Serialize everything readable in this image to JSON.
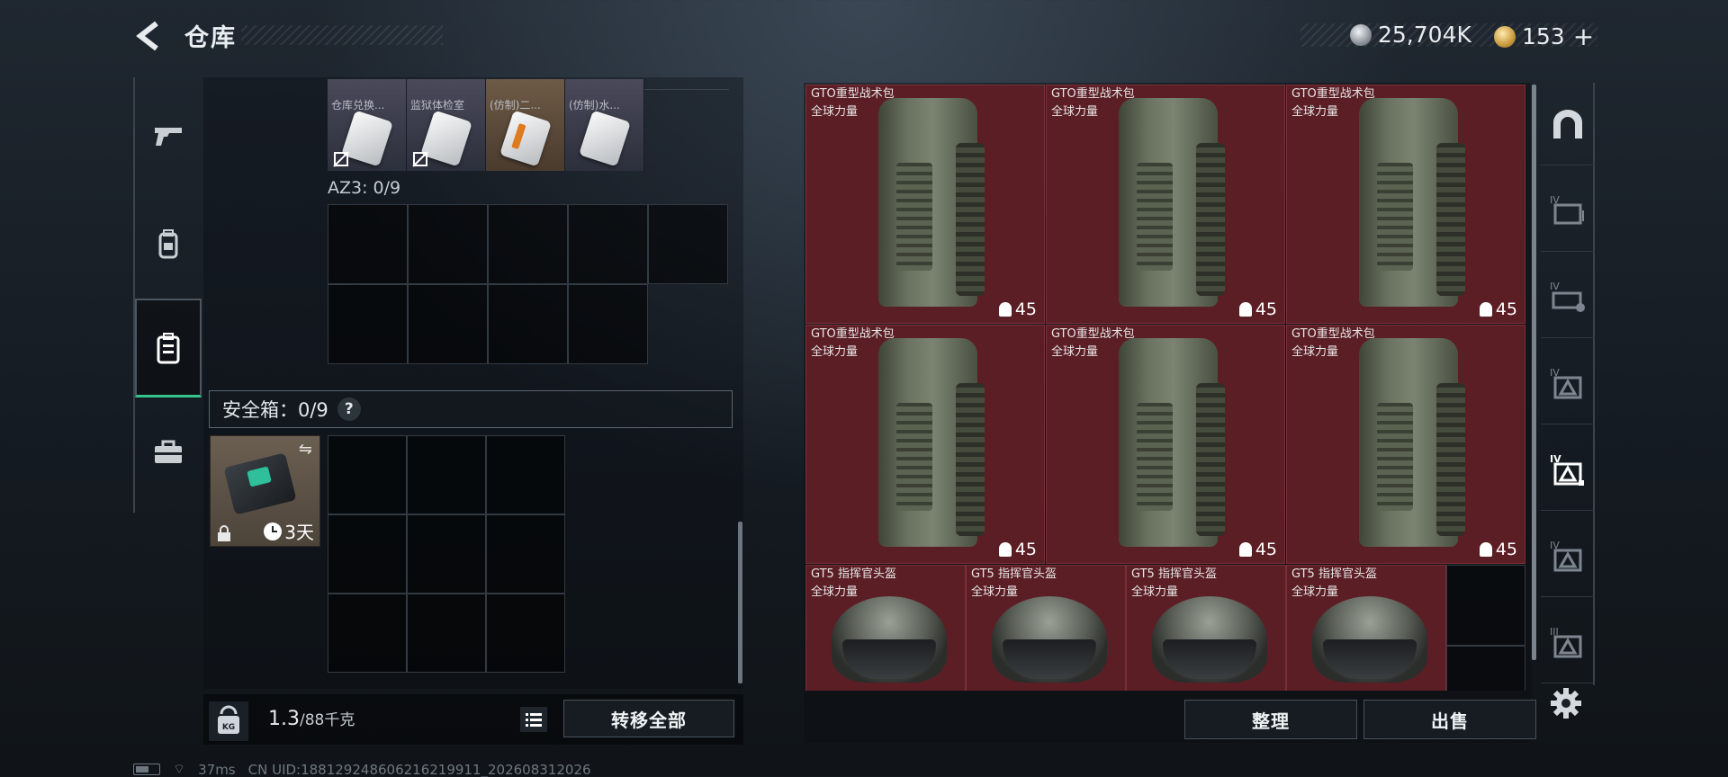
{
  "header": {
    "title": "仓库",
    "currency_silver": "25,704K",
    "currency_gold": "153",
    "add_label": "+"
  },
  "left_nav": {
    "items": [
      {
        "name": "weapons",
        "icon": "pistol-icon"
      },
      {
        "name": "equipment",
        "icon": "backpack-icon"
      },
      {
        "name": "storage",
        "icon": "case-icon",
        "active": true
      },
      {
        "name": "kit",
        "icon": "briefcase-icon"
      }
    ]
  },
  "carried": {
    "mini_items": [
      {
        "label": "仓库兑换...",
        "style": "card"
      },
      {
        "label": "监狱体检室",
        "style": "card"
      },
      {
        "label": "(仿制)二...",
        "style": "card-orange"
      },
      {
        "label": "(仿制)水...",
        "style": "card"
      }
    ],
    "az3_label": "AZ3: 0/9",
    "safe_label": "安全箱：0/9",
    "safe_help": "?",
    "safe_timer": "3天",
    "weight_value": "1.3",
    "weight_max": "/88千克",
    "transfer_all": "转移全部"
  },
  "warehouse": {
    "items": [
      {
        "name": "GTO重型战术包",
        "tag": "全球力量",
        "count": "45"
      },
      {
        "name": "GTO重型战术包",
        "tag": "全球力量",
        "count": "45"
      },
      {
        "name": "GTO重型战术包",
        "tag": "全球力量",
        "count": "45"
      },
      {
        "name": "GTO重型战术包",
        "tag": "全球力量",
        "count": "45"
      },
      {
        "name": "GTO重型战术包",
        "tag": "全球力量",
        "count": "45"
      },
      {
        "name": "GTO重型战术包",
        "tag": "全球力量",
        "count": "45"
      }
    ],
    "helmets": [
      {
        "name": "GT5 指挥官头盔",
        "tag": "全球力量"
      },
      {
        "name": "GT5 指挥官头盔",
        "tag": "全球力量"
      },
      {
        "name": "GT5 指挥官头盔",
        "tag": "全球力量"
      },
      {
        "name": "GT5 指挥官头盔",
        "tag": "全球力量"
      }
    ],
    "sort_label": "整理",
    "sell_label": "出售"
  },
  "right_nav": {
    "items": [
      {
        "name": "all",
        "icon": "arch-icon"
      },
      {
        "name": "tier-IV-folder",
        "icon": "iv-folder-icon",
        "tier": "IV"
      },
      {
        "name": "tier-IV-gear",
        "icon": "iv-gear-icon",
        "tier": "IV"
      },
      {
        "name": "tier-IV-tri",
        "icon": "iv-triangle-icon",
        "tier": "IV"
      },
      {
        "name": "tier-IV-tri-active",
        "icon": "iv-triangle-icon",
        "tier": "IV",
        "active": true
      },
      {
        "name": "tier-IV-tri-2",
        "icon": "iv-triangle-icon",
        "tier": "IV"
      },
      {
        "name": "tier-III",
        "icon": "iii-triangle-icon",
        "tier": "III"
      }
    ]
  },
  "status": {
    "ping": "37ms",
    "uid": "CN UID:18812924860621621991​1_202608312026"
  },
  "colors": {
    "item_bg": "#5c1e25",
    "active_accent": "#34c58a"
  }
}
